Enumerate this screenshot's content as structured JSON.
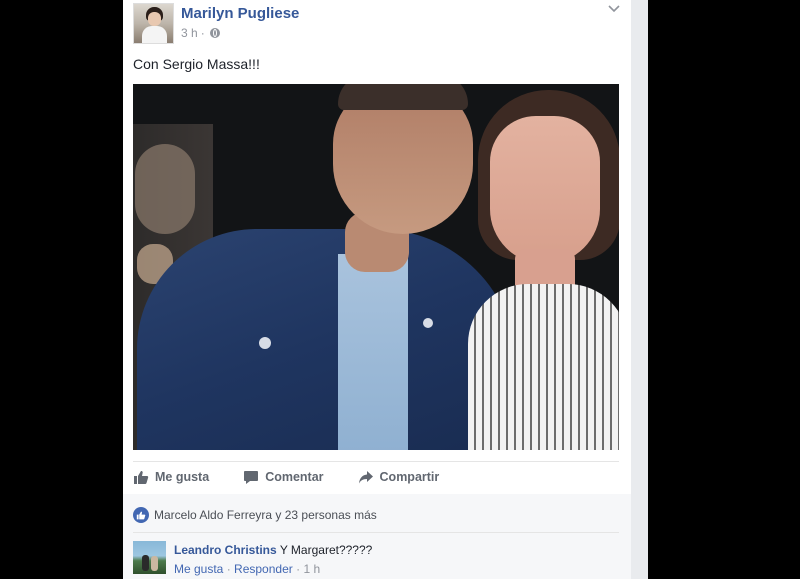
{
  "post": {
    "author": "Marilyn Pugliese",
    "time": "3 h",
    "time_separator": "·",
    "text": "Con Sergio Massa!!!"
  },
  "actions": {
    "like": "Me gusta",
    "comment": "Comentar",
    "share": "Compartir"
  },
  "reactions": {
    "summary": "Marcelo Aldo Ferreyra y 23 personas más"
  },
  "comment": {
    "author": "Leandro Christins",
    "text": "Y Margaret?????",
    "like": "Me gusta",
    "separator1": "·",
    "reply": "Responder",
    "separator2": "·",
    "time": "1 h"
  },
  "colors": {
    "link": "#365899",
    "accent": "#4267b2",
    "muted": "#90949c"
  },
  "icons": [
    "globe-icon",
    "chevron-down-icon",
    "like-icon",
    "comment-icon",
    "share-icon",
    "like-badge-icon"
  ]
}
